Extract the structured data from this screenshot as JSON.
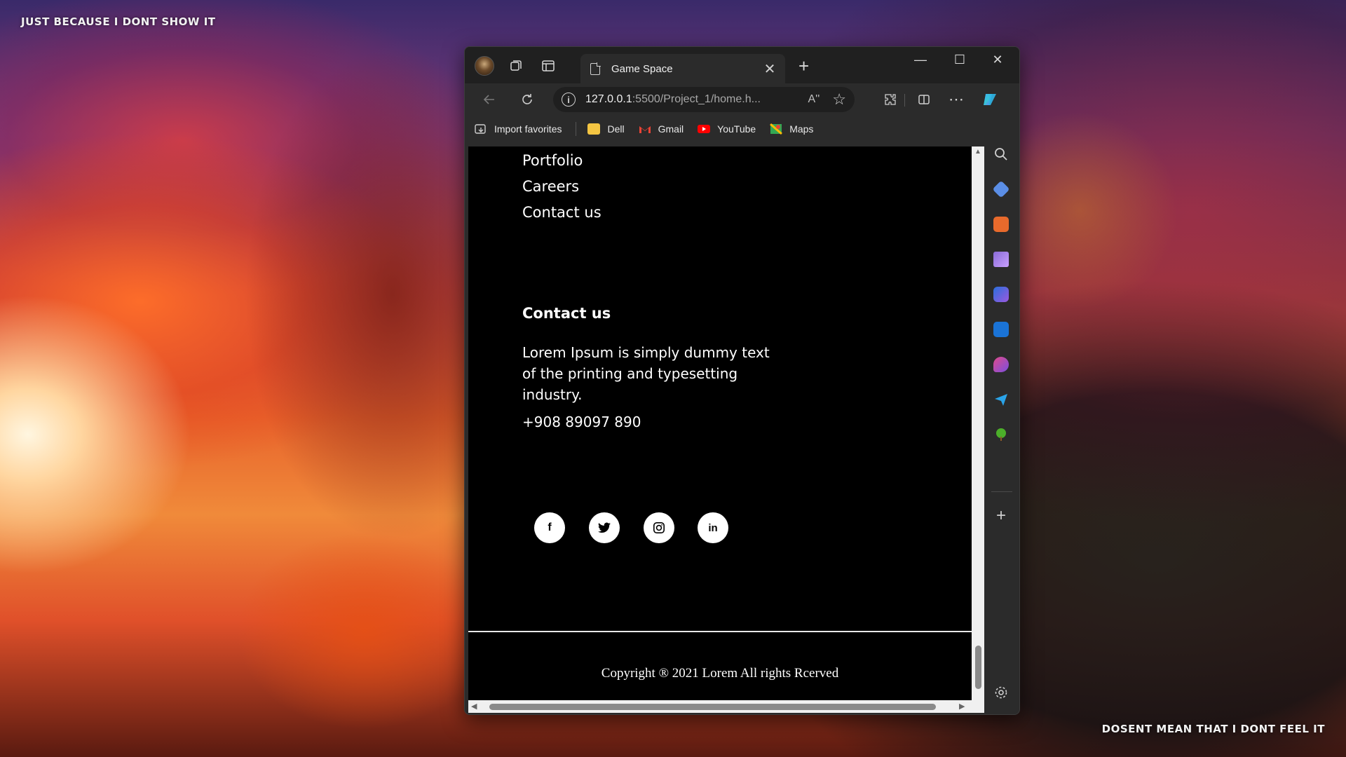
{
  "desktop": {
    "top_text": "JUST BECAUSE I DONT SHOW IT",
    "bottom_text": "DOSENT MEAN THAT I DONT FEEL IT"
  },
  "browser": {
    "tab_title": "Game Space",
    "tab_close": "✕",
    "new_tab": "+",
    "window_controls": {
      "minimize": "—",
      "maximize": "☐",
      "close": "✕"
    },
    "url_host": "127.0.0.1",
    "url_rest": ":5500/Project_1/home.h...",
    "read_aloud": "A''",
    "bookmarks": [
      {
        "label": "Import favorites",
        "icon": "import-icon",
        "color": "#cfcfcf"
      },
      {
        "label": "Dell",
        "icon": "folder-icon",
        "color": "#f4c542"
      },
      {
        "label": "Gmail",
        "icon": "gmail-icon",
        "color": "#ea4335"
      },
      {
        "label": "YouTube",
        "icon": "youtube-icon",
        "color": "#ff0000"
      },
      {
        "label": "Maps",
        "icon": "maps-icon",
        "color": "#34a853"
      }
    ]
  },
  "page": {
    "nav_links": [
      "Portfolio",
      "Careers",
      "Contact us"
    ],
    "contact": {
      "heading": "Contact us",
      "text": "Lorem Ipsum is simply dummy text of the printing and typesetting industry.",
      "phone": "+908 89097 890"
    },
    "social": [
      {
        "icon": "facebook-icon",
        "glyph": "f"
      },
      {
        "icon": "twitter-icon",
        "glyph": "🐦"
      },
      {
        "icon": "instagram-icon",
        "glyph": "◎"
      },
      {
        "icon": "linkedin-icon",
        "glyph": "in"
      }
    ],
    "copyright": "Copyright ® 2021 Lorem All rights Rcerved"
  },
  "colors": {
    "page_bg": "#000000",
    "browser_chrome": "#2b2b2b",
    "titlebar": "#202020"
  }
}
